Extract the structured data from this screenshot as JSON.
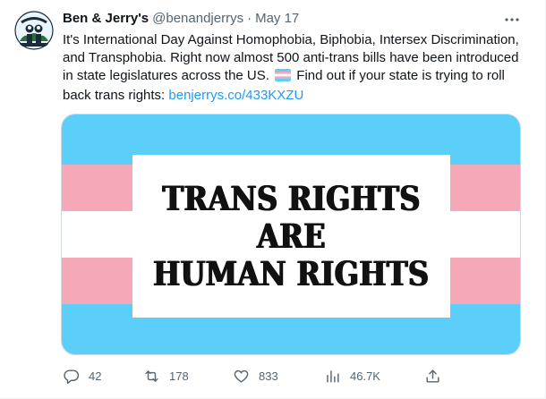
{
  "tweet": {
    "display_name": "Ben & Jerry's",
    "handle": "@benandjerrys",
    "separator": "·",
    "date": "May 17",
    "text_before_flag": "It's International Day Against Homophobia, Biphobia, Intersex Discrimination, and Transphobia. Right now almost 500 anti-trans bills have been introduced in state legislatures across the US.",
    "flag_emoji": "transgender-flag-emoji",
    "text_after_flag": "Find out if your state is trying to roll back trans rights:",
    "link": "benjerrys.co/433KXZU",
    "more_icon": "more-horizontal-icon"
  },
  "media": {
    "flag_colors": [
      "#5bcefa",
      "#f5a9b8",
      "#ffffff",
      "#f5a9b8",
      "#5bcefa"
    ],
    "sign_lines": [
      "TRANS RIGHTS",
      "ARE",
      "HUMAN RIGHTS"
    ]
  },
  "actions": {
    "replies": {
      "icon": "reply-icon",
      "count": "42"
    },
    "retweets": {
      "icon": "retweet-icon",
      "count": "178"
    },
    "likes": {
      "icon": "like-icon",
      "count": "833"
    },
    "views": {
      "icon": "views-icon",
      "count": "46.7K"
    },
    "share": {
      "icon": "share-icon"
    }
  },
  "colors": {
    "text": "#0f1419",
    "secondary": "#536471",
    "link": "#1d9bf0"
  }
}
